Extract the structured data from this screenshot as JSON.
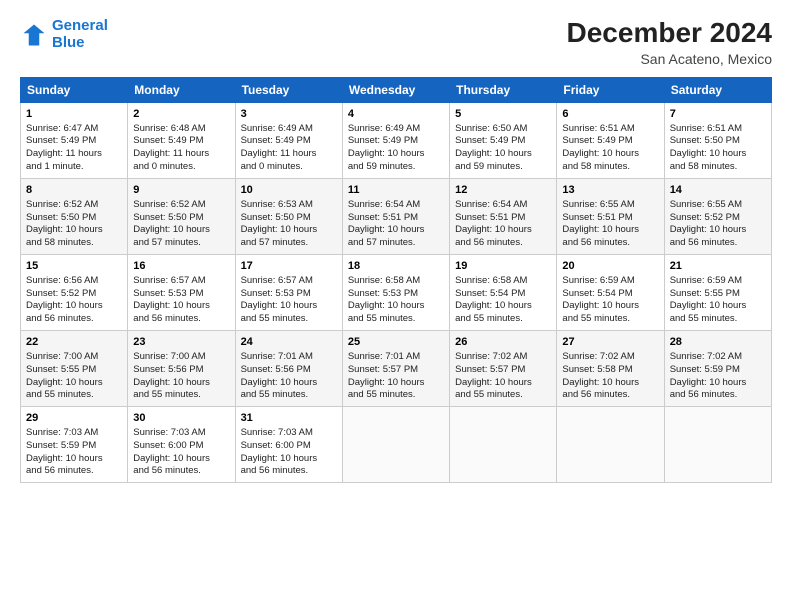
{
  "header": {
    "logo_line1": "General",
    "logo_line2": "Blue",
    "title": "December 2024",
    "subtitle": "San Acateno, Mexico"
  },
  "days_of_week": [
    "Sunday",
    "Monday",
    "Tuesday",
    "Wednesday",
    "Thursday",
    "Friday",
    "Saturday"
  ],
  "weeks": [
    [
      {
        "day": "1",
        "content": "Sunrise: 6:47 AM\nSunset: 5:49 PM\nDaylight: 11 hours\nand 1 minute."
      },
      {
        "day": "2",
        "content": "Sunrise: 6:48 AM\nSunset: 5:49 PM\nDaylight: 11 hours\nand 0 minutes."
      },
      {
        "day": "3",
        "content": "Sunrise: 6:49 AM\nSunset: 5:49 PM\nDaylight: 11 hours\nand 0 minutes."
      },
      {
        "day": "4",
        "content": "Sunrise: 6:49 AM\nSunset: 5:49 PM\nDaylight: 10 hours\nand 59 minutes."
      },
      {
        "day": "5",
        "content": "Sunrise: 6:50 AM\nSunset: 5:49 PM\nDaylight: 10 hours\nand 59 minutes."
      },
      {
        "day": "6",
        "content": "Sunrise: 6:51 AM\nSunset: 5:49 PM\nDaylight: 10 hours\nand 58 minutes."
      },
      {
        "day": "7",
        "content": "Sunrise: 6:51 AM\nSunset: 5:50 PM\nDaylight: 10 hours\nand 58 minutes."
      }
    ],
    [
      {
        "day": "8",
        "content": "Sunrise: 6:52 AM\nSunset: 5:50 PM\nDaylight: 10 hours\nand 58 minutes."
      },
      {
        "day": "9",
        "content": "Sunrise: 6:52 AM\nSunset: 5:50 PM\nDaylight: 10 hours\nand 57 minutes."
      },
      {
        "day": "10",
        "content": "Sunrise: 6:53 AM\nSunset: 5:50 PM\nDaylight: 10 hours\nand 57 minutes."
      },
      {
        "day": "11",
        "content": "Sunrise: 6:54 AM\nSunset: 5:51 PM\nDaylight: 10 hours\nand 57 minutes."
      },
      {
        "day": "12",
        "content": "Sunrise: 6:54 AM\nSunset: 5:51 PM\nDaylight: 10 hours\nand 56 minutes."
      },
      {
        "day": "13",
        "content": "Sunrise: 6:55 AM\nSunset: 5:51 PM\nDaylight: 10 hours\nand 56 minutes."
      },
      {
        "day": "14",
        "content": "Sunrise: 6:55 AM\nSunset: 5:52 PM\nDaylight: 10 hours\nand 56 minutes."
      }
    ],
    [
      {
        "day": "15",
        "content": "Sunrise: 6:56 AM\nSunset: 5:52 PM\nDaylight: 10 hours\nand 56 minutes."
      },
      {
        "day": "16",
        "content": "Sunrise: 6:57 AM\nSunset: 5:53 PM\nDaylight: 10 hours\nand 56 minutes."
      },
      {
        "day": "17",
        "content": "Sunrise: 6:57 AM\nSunset: 5:53 PM\nDaylight: 10 hours\nand 55 minutes."
      },
      {
        "day": "18",
        "content": "Sunrise: 6:58 AM\nSunset: 5:53 PM\nDaylight: 10 hours\nand 55 minutes."
      },
      {
        "day": "19",
        "content": "Sunrise: 6:58 AM\nSunset: 5:54 PM\nDaylight: 10 hours\nand 55 minutes."
      },
      {
        "day": "20",
        "content": "Sunrise: 6:59 AM\nSunset: 5:54 PM\nDaylight: 10 hours\nand 55 minutes."
      },
      {
        "day": "21",
        "content": "Sunrise: 6:59 AM\nSunset: 5:55 PM\nDaylight: 10 hours\nand 55 minutes."
      }
    ],
    [
      {
        "day": "22",
        "content": "Sunrise: 7:00 AM\nSunset: 5:55 PM\nDaylight: 10 hours\nand 55 minutes."
      },
      {
        "day": "23",
        "content": "Sunrise: 7:00 AM\nSunset: 5:56 PM\nDaylight: 10 hours\nand 55 minutes."
      },
      {
        "day": "24",
        "content": "Sunrise: 7:01 AM\nSunset: 5:56 PM\nDaylight: 10 hours\nand 55 minutes."
      },
      {
        "day": "25",
        "content": "Sunrise: 7:01 AM\nSunset: 5:57 PM\nDaylight: 10 hours\nand 55 minutes."
      },
      {
        "day": "26",
        "content": "Sunrise: 7:02 AM\nSunset: 5:57 PM\nDaylight: 10 hours\nand 55 minutes."
      },
      {
        "day": "27",
        "content": "Sunrise: 7:02 AM\nSunset: 5:58 PM\nDaylight: 10 hours\nand 56 minutes."
      },
      {
        "day": "28",
        "content": "Sunrise: 7:02 AM\nSunset: 5:59 PM\nDaylight: 10 hours\nand 56 minutes."
      }
    ],
    [
      {
        "day": "29",
        "content": "Sunrise: 7:03 AM\nSunset: 5:59 PM\nDaylight: 10 hours\nand 56 minutes."
      },
      {
        "day": "30",
        "content": "Sunrise: 7:03 AM\nSunset: 6:00 PM\nDaylight: 10 hours\nand 56 minutes."
      },
      {
        "day": "31",
        "content": "Sunrise: 7:03 AM\nSunset: 6:00 PM\nDaylight: 10 hours\nand 56 minutes."
      },
      {
        "day": "",
        "content": ""
      },
      {
        "day": "",
        "content": ""
      },
      {
        "day": "",
        "content": ""
      },
      {
        "day": "",
        "content": ""
      }
    ]
  ]
}
